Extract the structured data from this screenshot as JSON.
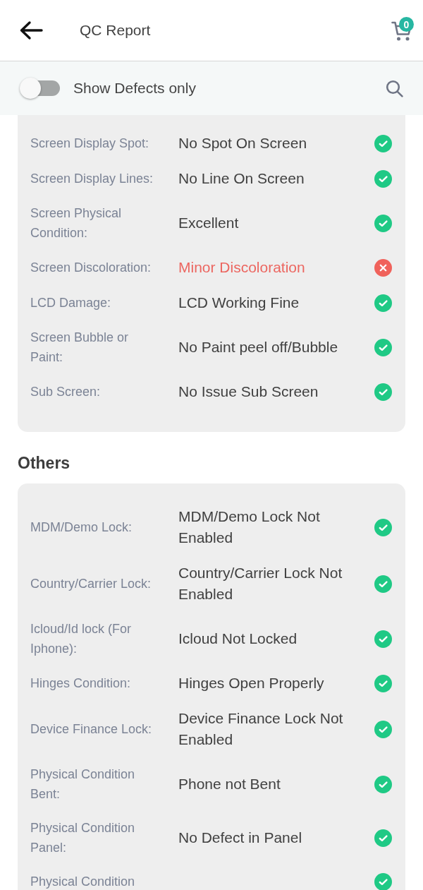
{
  "header": {
    "title": "QC Report",
    "cart_count": "0"
  },
  "filter_bar": {
    "toggle": {
      "label": "Show Defects only",
      "on": false
    }
  },
  "sections": [
    {
      "items": [
        {
          "label": "Screen Display Spot:",
          "value": "No Spot On Screen",
          "defect": false
        },
        {
          "label": "Screen Display Lines:",
          "value": "No Line On Screen",
          "defect": false
        },
        {
          "label": "Screen Physical Condition:",
          "value": "Excellent",
          "defect": false
        },
        {
          "label": "Screen Discoloration:",
          "value": "Minor Discoloration",
          "defect": true
        },
        {
          "label": "LCD Damage:",
          "value": "LCD Working Fine",
          "defect": false
        },
        {
          "label": "Screen Bubble or Paint:",
          "value": "No Paint peel off/Bubble",
          "defect": false
        },
        {
          "label": "Sub Screen:",
          "value": "No Issue Sub Screen",
          "defect": false
        }
      ]
    },
    {
      "title": "Others",
      "items": [
        {
          "label": "MDM/Demo Lock:",
          "value": "MDM/Demo Lock Not Enabled",
          "defect": false
        },
        {
          "label": "Country/Carrier Lock:",
          "value": "Country/Carrier Lock Not Enabled",
          "defect": false
        },
        {
          "label": "Icloud/Id lock (For Iphone):",
          "value": "Icloud Not Locked",
          "defect": false
        },
        {
          "label": "Hinges Condition:",
          "value": "Hinges Open Properly",
          "defect": false
        },
        {
          "label": "Device Finance Lock:",
          "value": "Device Finance Lock Not Enabled",
          "defect": false
        },
        {
          "label": "Physical Condition Bent:",
          "value": "Phone not Bent",
          "defect": false
        },
        {
          "label": "Physical Condition Panel:",
          "value": "No Defect in Panel",
          "defect": false
        },
        {
          "label": "Physical Condition",
          "defect": false
        }
      ]
    }
  ]
}
